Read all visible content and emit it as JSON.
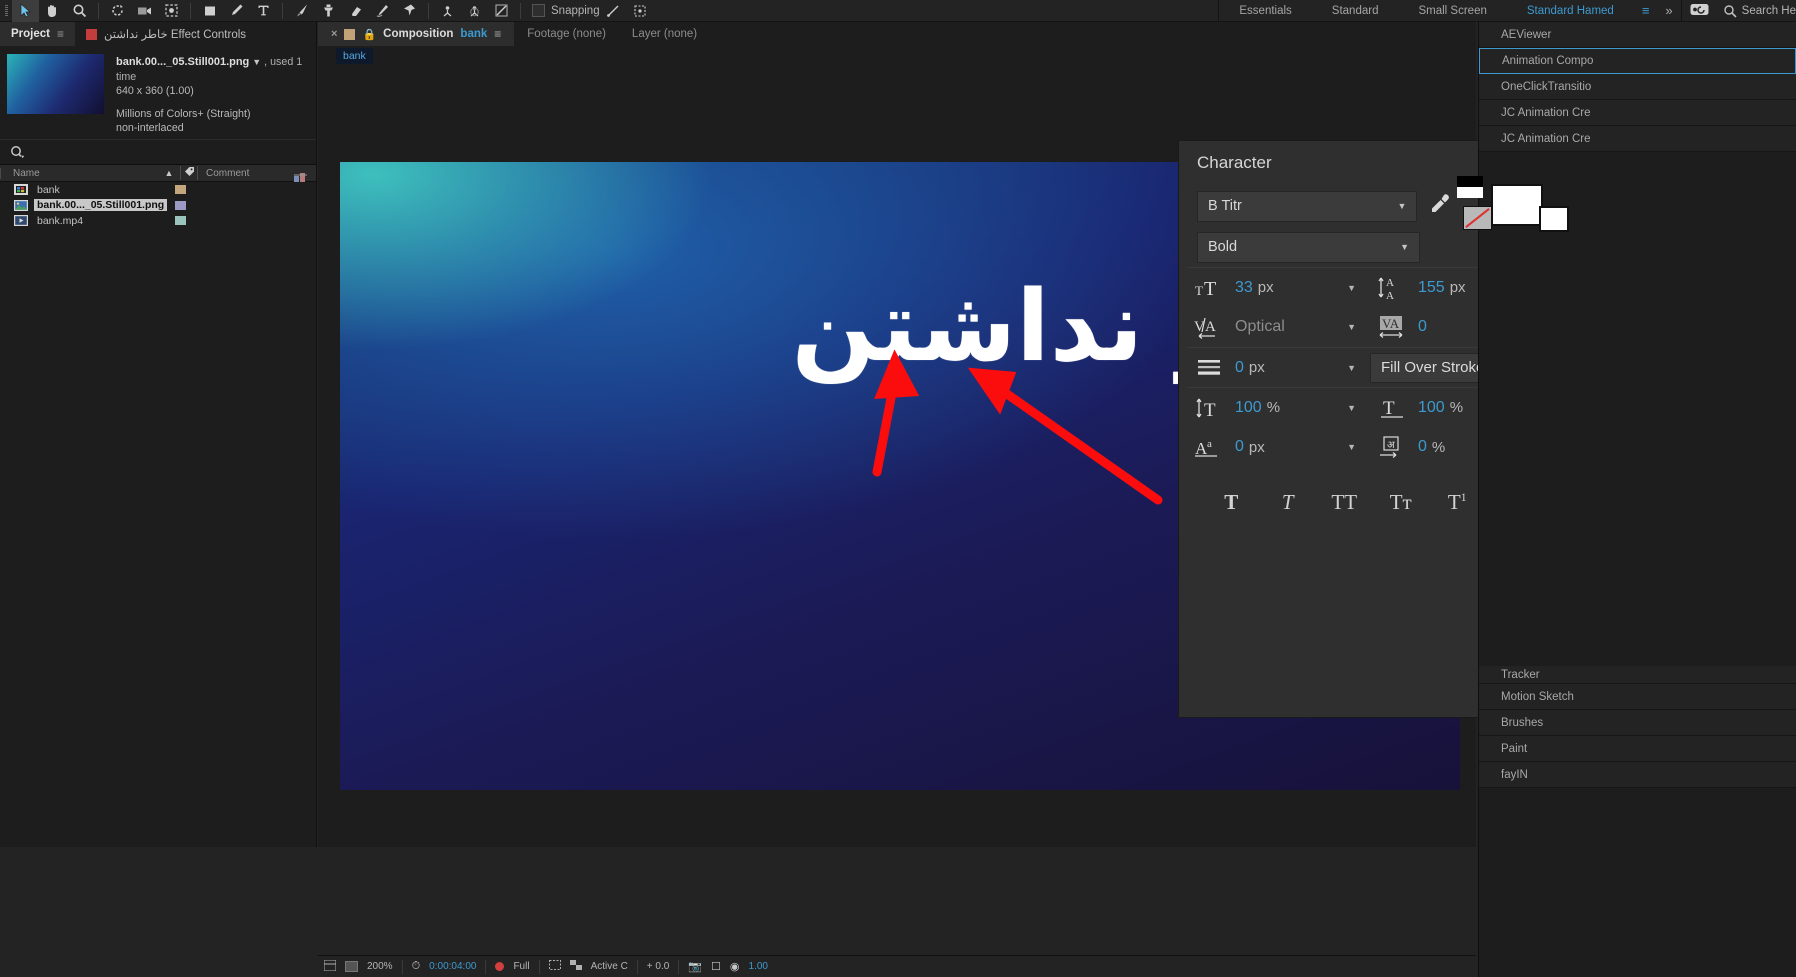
{
  "toolbar": {
    "tools": [
      {
        "name": "selection-tool",
        "glyph": "➤",
        "selected": true
      },
      {
        "name": "hand-tool",
        "glyph": "✋",
        "selected": false
      },
      {
        "name": "zoom-tool",
        "glyph": "⌕",
        "selected": false
      },
      {
        "name": "rotation-tool",
        "glyph": "↻",
        "selected": false
      },
      {
        "name": "camera-tool",
        "glyph": "▣",
        "selected": false
      },
      {
        "name": "anchor-point-tool",
        "glyph": "⌘",
        "selected": false
      },
      {
        "name": "shape-tool",
        "glyph": "■",
        "selected": false
      },
      {
        "name": "pen-tool",
        "glyph": "✒",
        "selected": false
      },
      {
        "name": "type-tool",
        "glyph": "T",
        "selected": false
      },
      {
        "name": "brush-tool",
        "glyph": "╱",
        "selected": false
      },
      {
        "name": "clone-stamp-tool",
        "glyph": "⚓",
        "selected": false
      },
      {
        "name": "eraser-tool",
        "glyph": "▭",
        "selected": false
      },
      {
        "name": "roto-brush-tool",
        "glyph": "✐",
        "selected": false
      },
      {
        "name": "puppet-pin-tool",
        "glyph": "✁",
        "selected": false
      },
      {
        "name": "unified-camera-tool",
        "glyph": "✡",
        "selected": false
      },
      {
        "name": "orbit-tool",
        "glyph": "⛬",
        "selected": false
      },
      {
        "name": "pan-behind-tool",
        "glyph": "⬚",
        "selected": false
      }
    ],
    "snapping_label": "Snapping"
  },
  "workspaces": {
    "tabs": [
      {
        "label": "Essentials",
        "active": false
      },
      {
        "label": "Standard",
        "active": false
      },
      {
        "label": "Small Screen",
        "active": false
      },
      {
        "label": "Standard Hamed",
        "active": true
      }
    ],
    "menu_icon": "≡",
    "overflow_icon": "»",
    "sync_icon": "⧉",
    "search_icon": "search-icon",
    "search_label": "Search He"
  },
  "project": {
    "tabs": [
      {
        "label": "Project",
        "active": true,
        "menu": "≡"
      },
      {
        "label": "Effect Controls خاطر نداشتن",
        "active": false
      }
    ],
    "preview": {
      "filename": "bank.00..._05.Still001.png",
      "used": ", used 1 time",
      "dimensions": "640 x 360 (1.00)",
      "colors": "Millions of Colors+ (Straight)",
      "interlace": "non-interlaced"
    },
    "search_placeholder": "",
    "columns": {
      "name": "Name",
      "comment": "Comment"
    },
    "items": [
      {
        "label": "bank",
        "type": "composition",
        "swatch": "#c3a67c",
        "selected": false
      },
      {
        "label": "bank.00..._05.Still001.png",
        "type": "image",
        "swatch": "#9a9ac4",
        "selected": true
      },
      {
        "label": "bank.mp4",
        "type": "video",
        "swatch": "#9ac4bb",
        "selected": false
      }
    ]
  },
  "composition": {
    "tabs": [
      {
        "label": "Composition",
        "name": "bank",
        "active": true
      },
      {
        "label": "Footage (none)",
        "name": "",
        "active": false
      },
      {
        "label": "Layer (none)",
        "name": "",
        "active": false
      }
    ],
    "breadcrumb": "bank",
    "canvas_text": "خاطر نداشتن"
  },
  "character": {
    "title": "Character",
    "menu_icon": "≡",
    "font_family": "B Titr",
    "font_style": "Bold",
    "font_size": {
      "icon": "font-size-icon",
      "value": "33",
      "unit": "px"
    },
    "leading": {
      "icon": "leading-icon",
      "value": "155",
      "unit": "px"
    },
    "kerning": {
      "icon": "kerning-icon",
      "value": "Optical",
      "unit": "",
      "muted": true
    },
    "tracking": {
      "icon": "tracking-icon",
      "value": "0",
      "unit": ""
    },
    "stroke_width": {
      "icon": "stroke-width-icon",
      "value": "0",
      "unit": "px"
    },
    "fill_stroke_order": "Fill Over Stroke",
    "vertical_scale": {
      "icon": "vertical-scale-icon",
      "value": "100",
      "unit": "%"
    },
    "horizontal_scale": {
      "icon": "horizontal-scale-icon",
      "value": "100",
      "unit": "%"
    },
    "baseline_shift": {
      "icon": "baseline-shift-icon",
      "value": "0",
      "unit": "px"
    },
    "tsume": {
      "icon": "tsume-icon",
      "value": "0",
      "unit": "%"
    },
    "style_buttons": [
      {
        "name": "faux-bold",
        "glyph": "T"
      },
      {
        "name": "faux-italic",
        "glyph": "T"
      },
      {
        "name": "all-caps",
        "glyph": "TT"
      },
      {
        "name": "small-caps",
        "glyph": "Tᴛ"
      },
      {
        "name": "superscript",
        "glyph": "T"
      },
      {
        "name": "subscript",
        "glyph": "T"
      }
    ],
    "eyedropper_icon": "eyedropper-icon",
    "swap_icon": "swap-fill-stroke-icon"
  },
  "right_dock": {
    "top_items": [
      {
        "label": "AEViewer",
        "active": false
      },
      {
        "label": "Animation Compo",
        "active": true
      },
      {
        "label": "OneClickTransitio",
        "active": false
      },
      {
        "label": "JC Animation Cre",
        "active": false
      },
      {
        "label": "JC Animation Cre",
        "active": false
      }
    ],
    "bottom_items": [
      {
        "label": "Tracker",
        "active": false
      },
      {
        "label": "Motion Sketch",
        "active": false
      },
      {
        "label": "Brushes",
        "active": false
      },
      {
        "label": "Paint",
        "active": false
      },
      {
        "label": "fayIN",
        "active": false
      }
    ]
  },
  "status_bar": {
    "zoom": "200%",
    "timecode": "0:00:04:00",
    "resolution": "Full",
    "quality": "Active C",
    "exposure": "+ 0.0",
    "fps": "1.00",
    "mode_label": ""
  }
}
